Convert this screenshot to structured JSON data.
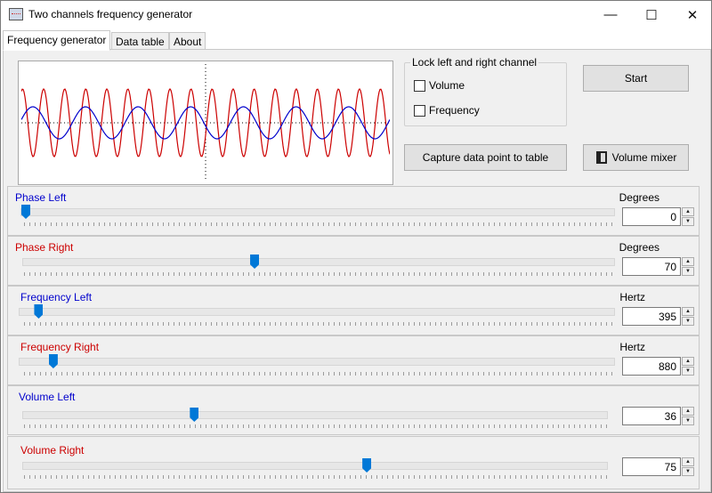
{
  "window": {
    "title": "Two channels frequency generator",
    "minimize": "—",
    "maximize": "☐",
    "close": "✕",
    "icon": "app-icon"
  },
  "tabs": [
    {
      "label": "Frequency generator"
    },
    {
      "label": "Data table"
    },
    {
      "label": "About"
    }
  ],
  "lock_group": {
    "legend": "Lock left and right channel",
    "volume_label": "Volume",
    "frequency_label": "Frequency",
    "volume_checked": false,
    "frequency_checked": false
  },
  "buttons": {
    "start": "Start",
    "capture": "Capture data point to table",
    "volume_mixer": "Volume mixer",
    "volume_mixer_icon": "speaker-icon"
  },
  "scope": {
    "colors": {
      "left": "#0000cc",
      "right": "#cc0000"
    }
  },
  "controls": {
    "phase_left": {
      "label": "Phase Left",
      "unit": "Degrees",
      "value": "0",
      "fraction": 0.0
    },
    "phase_right": {
      "label": "Phase Right",
      "unit": "Degrees",
      "value": "70",
      "fraction": 0.39
    },
    "frequency_left": {
      "label": "Frequency Left",
      "unit": "Hertz",
      "value": "395",
      "fraction": 0.025
    },
    "frequency_right": {
      "label": "Frequency Right",
      "unit": "Hertz",
      "value": "880",
      "fraction": 0.05
    },
    "volume_left": {
      "label": "Volume Left",
      "unit": "",
      "value": "36",
      "fraction": 0.29
    },
    "volume_right": {
      "label": "Volume Right",
      "unit": "",
      "value": "75",
      "fraction": 0.59
    }
  }
}
